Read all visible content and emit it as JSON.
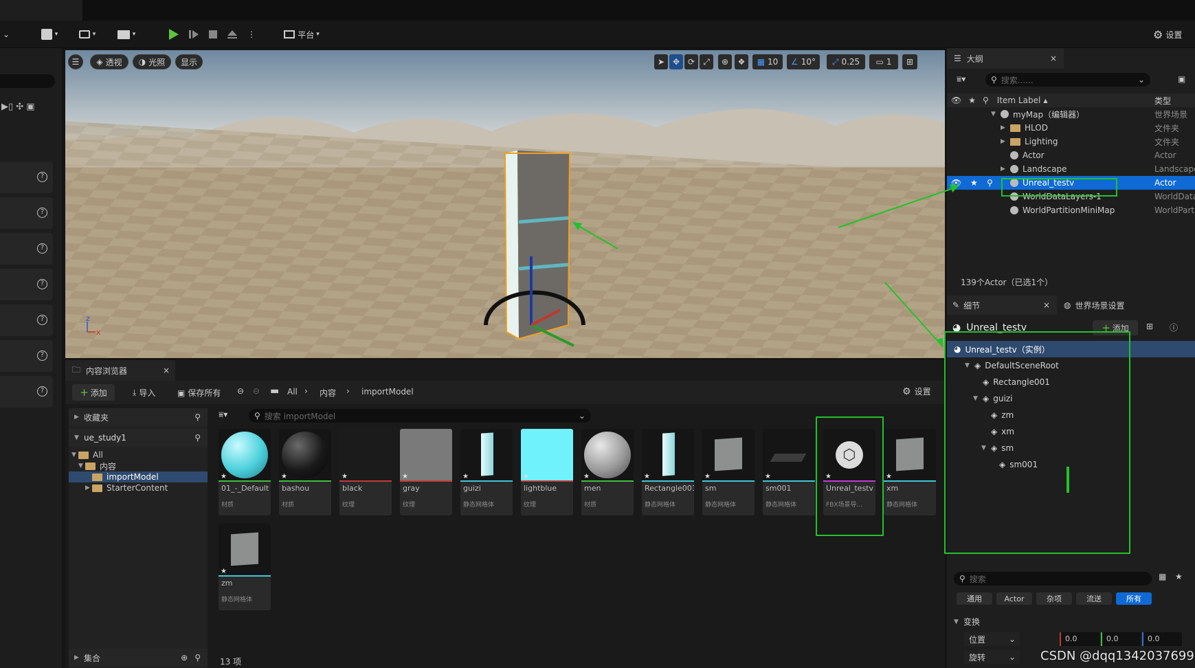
{
  "toolbar": {
    "platform_label": "平台",
    "settings_label": "设置"
  },
  "viewport": {
    "perspective": "透视",
    "lit": "光照",
    "show": "显示",
    "grid_snap": "10",
    "angle_snap": "10°",
    "scale_snap": "0.25",
    "camera_speed": "1"
  },
  "content_browser": {
    "tab_title": "内容浏览器",
    "add": "添加",
    "import": "导入",
    "save_all": "保存所有",
    "breadcrumb": [
      "All",
      "内容",
      "importModel"
    ],
    "settings": "设置",
    "favorites": "收藏夹",
    "project": "ue_study1",
    "tree": [
      {
        "label": "All",
        "level": 0
      },
      {
        "label": "内容",
        "level": 1
      },
      {
        "label": "importModel",
        "level": 2,
        "selected": true
      },
      {
        "label": "StarterContent",
        "level": 2
      }
    ],
    "collections": "集合",
    "search_placeholder": "搜索 importModel",
    "item_count": "13 项",
    "assets": [
      {
        "name": "01_-_Default",
        "type": "材质",
        "bar": "#3fbf3f",
        "thumb": "sphere-cyan"
      },
      {
        "name": "bashou",
        "type": "材质",
        "bar": "#3fbf3f",
        "thumb": "sphere-black"
      },
      {
        "name": "black",
        "type": "纹理",
        "bar": "#c23b3b",
        "thumb": "dark"
      },
      {
        "name": "gray",
        "type": "纹理",
        "bar": "#c23b3b",
        "thumb": "gray"
      },
      {
        "name": "guizi",
        "type": "静态网格体",
        "bar": "#3ec9d6",
        "thumb": "slab-cyan"
      },
      {
        "name": "lightblue",
        "type": "纹理",
        "bar": "#c23b3b",
        "thumb": "cyan"
      },
      {
        "name": "men",
        "type": "材质",
        "bar": "#3fbf3f",
        "thumb": "sphere-gray"
      },
      {
        "name": "Rectangle001",
        "type": "静态网格体",
        "bar": "#3ec9d6",
        "thumb": "slab-cyan"
      },
      {
        "name": "sm",
        "type": "静态网格体",
        "bar": "#3ec9d6",
        "thumb": "panel-gray"
      },
      {
        "name": "sm001",
        "type": "静态网格体",
        "bar": "#3ec9d6",
        "thumb": "flat-dark"
      },
      {
        "name": "Unreal_testv",
        "type": "FBX场景导...",
        "bar": "#c23bd6",
        "thumb": "cube-icon"
      },
      {
        "name": "xm",
        "type": "静态网格体",
        "bar": "#3ec9d6",
        "thumb": "panel-gray"
      },
      {
        "name": "zm",
        "type": "静态网格体",
        "bar": "#3ec9d6",
        "thumb": "panel-gray"
      }
    ]
  },
  "outliner": {
    "tab_title": "大纲",
    "search_placeholder": "搜索......",
    "col_label": "Item Label",
    "col_type": "类型",
    "rows": [
      {
        "label": "myMap（编辑器）",
        "type": "世界场景",
        "indent": 0
      },
      {
        "label": "HLOD",
        "type": "文件夹",
        "indent": 1
      },
      {
        "label": "Lighting",
        "type": "文件夹",
        "indent": 1
      },
      {
        "label": "Actor",
        "type": "Actor",
        "indent": 1
      },
      {
        "label": "Landscape",
        "type": "Landscape",
        "indent": 1
      },
      {
        "label": "Unreal_testv",
        "type": "Actor",
        "indent": 1,
        "selected": true
      },
      {
        "label": "WorldDataLayers-1",
        "type": "WorldData",
        "indent": 1
      },
      {
        "label": "WorldPartitionMiniMap",
        "type": "WorldPart",
        "indent": 1
      }
    ],
    "footer": "139个Actor（已选1个）"
  },
  "details": {
    "tab_details": "细节",
    "tab_world": "世界场景设置",
    "actor_name": "Unreal_testv",
    "add": "添加",
    "components": [
      {
        "label": "Unreal_testv（实例）",
        "indent": 0,
        "selected": true
      },
      {
        "label": "DefaultSceneRoot",
        "indent": 1
      },
      {
        "label": "Rectangle001",
        "indent": 2
      },
      {
        "label": "guizi",
        "indent": 2
      },
      {
        "label": "zm",
        "indent": 3
      },
      {
        "label": "xm",
        "indent": 3
      },
      {
        "label": "sm",
        "indent": 3
      },
      {
        "label": "sm001",
        "indent": 4
      }
    ],
    "search_placeholder": "搜索",
    "filters": [
      "通用",
      "Actor",
      "杂项",
      "流送",
      "所有"
    ],
    "transform_label": "变换",
    "location_label": "位置",
    "rotation_label": "旋转",
    "location_values": [
      "0.0",
      "0.0",
      "0.0"
    ]
  },
  "watermark": "CSDN @dqq1342037699"
}
